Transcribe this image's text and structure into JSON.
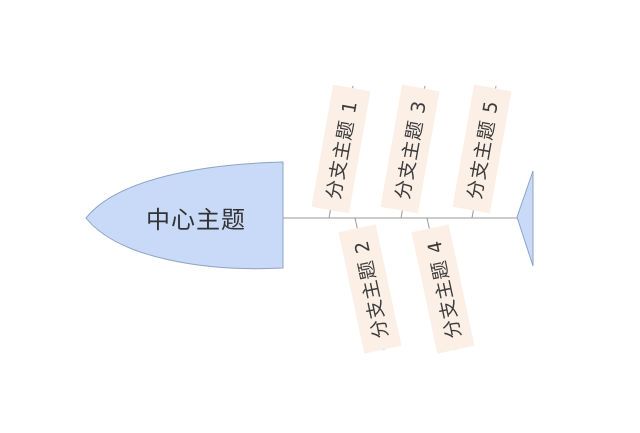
{
  "diagram": {
    "type": "fishbone",
    "head": {
      "label": "中心主题"
    },
    "branches": [
      {
        "id": 1,
        "label": "分支主题 1",
        "side": "top"
      },
      {
        "id": 2,
        "label": "分支主题 2",
        "side": "bottom"
      },
      {
        "id": 3,
        "label": "分支主题 3",
        "side": "top"
      },
      {
        "id": 4,
        "label": "分支主题 4",
        "side": "bottom"
      },
      {
        "id": 5,
        "label": "分支主题 5",
        "side": "top"
      }
    ],
    "colors": {
      "head_fill": "#c9daf8",
      "head_stroke": "#8ea3c4",
      "line": "#9a9a9a",
      "label_bg": "#fbefe6",
      "text": "#333333"
    }
  }
}
